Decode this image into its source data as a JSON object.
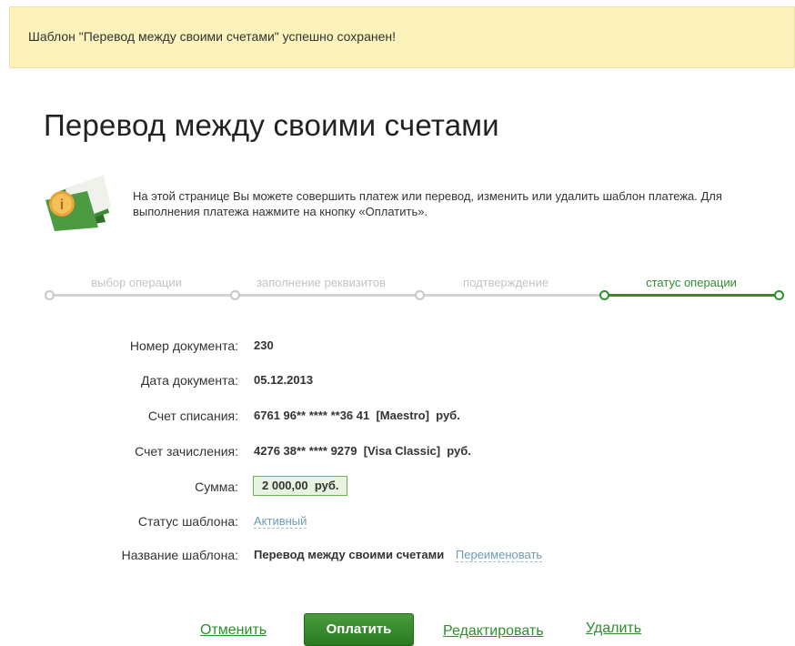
{
  "notice": {
    "text": "Шаблон \"Перевод между своими счетами\" успешно сохранен!"
  },
  "page": {
    "title": "Перевод между своими счетами"
  },
  "info": {
    "icon": "folder-info-icon",
    "text": "На этой странице Вы можете совершить платеж или перевод, изменить или удалить шаблон платежа. Для выполнения платежа нажмите на кнопку «Оплатить»."
  },
  "steps": [
    {
      "label": "выбор операции",
      "active": false
    },
    {
      "label": "заполнение реквизитов",
      "active": false
    },
    {
      "label": "подтверждение",
      "active": false
    },
    {
      "label": "статус операции",
      "active": true
    }
  ],
  "colors": {
    "accent": "#2f8f2f",
    "inactive": "#c8c8c8",
    "link": "#6d9cb1",
    "notice_bg": "#fbf3bb"
  },
  "details": {
    "doc_number": {
      "label": "Номер документа:",
      "value": "230"
    },
    "doc_date": {
      "label": "Дата документа:",
      "value": "05.12.2013"
    },
    "debit_account": {
      "label": "Счет списания:",
      "value": "6761 96** **** **36 41  [Maestro]  руб."
    },
    "credit_account": {
      "label": "Счет зачисления:",
      "value": "4276 38** **** 9279  [Visa Classic]  руб."
    },
    "amount": {
      "label": "Сумма:",
      "value": "2 000,00  руб."
    },
    "template_status": {
      "label": "Статус шаблона:",
      "value": "Активный"
    },
    "template_name": {
      "label": "Название шаблона:",
      "value": "Перевод между своими счетами",
      "rename": "Переименовать"
    }
  },
  "actions": {
    "cancel": "Отменить",
    "pay": "Оплатить",
    "edit": "Редактировать",
    "delete": "Удалить"
  }
}
